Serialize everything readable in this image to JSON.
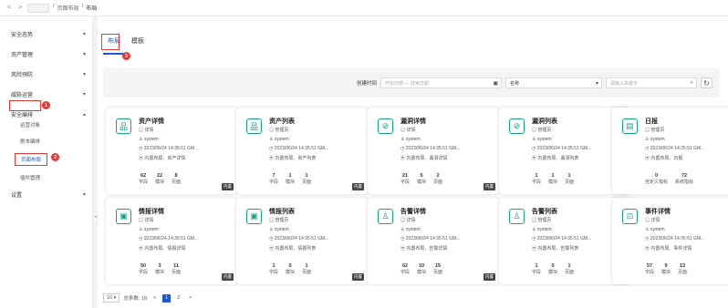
{
  "breadcrumb": {
    "back": "<",
    "forward": ">",
    "sep1": "/",
    "level1": "页面布局",
    "sep2": "/",
    "level2": "布局"
  },
  "sidebar": {
    "items": [
      {
        "label": "安全态势",
        "chev": "▾"
      },
      {
        "label": "资产管理",
        "chev": "▾"
      },
      {
        "label": "风险预防",
        "chev": "▾"
      },
      {
        "label": "威胁运营",
        "chev": "▾"
      },
      {
        "label": "安全编排",
        "chev": "▴"
      },
      {
        "label": "设置",
        "chev": "▾"
      }
    ],
    "subs": [
      "运营对象",
      "剧本编排",
      "页面布局",
      "插件管理"
    ],
    "collapse": "◂"
  },
  "badges": [
    "1",
    "2",
    "3"
  ],
  "tabs": [
    {
      "label": "布局"
    },
    {
      "label": "模板"
    }
  ],
  "filter": {
    "time_label": "创建时间",
    "date_placeholder": "开始日期 — 结束日期",
    "field_value": "名称",
    "keyword_placeholder": "请输入关键字",
    "calendar_glyph": "▣",
    "dropdown_glyph": "▾",
    "search_glyph": "⌕",
    "refresh_glyph": "↻"
  },
  "card_labels": {
    "field": "字段",
    "module": "模块",
    "page": "页面"
  },
  "cards": [
    {
      "title": "资产详情",
      "type": "详情",
      "user": "system",
      "time": "2023/06/24 14:35:51 GM...",
      "scope": "内置布局、资产详情",
      "fields": "62",
      "modules": "22",
      "pages": "8",
      "tag": "内置",
      "icon": "品"
    },
    {
      "title": "资产列表",
      "type": "管理页",
      "user": "system",
      "time": "2023/06/24 14:35:51 GM...",
      "scope": "内置布局、资产列表",
      "fields": "7",
      "modules": "1",
      "pages": "1",
      "tag": "内置",
      "icon": "品"
    },
    {
      "title": "漏洞详情",
      "type": "详情",
      "user": "system",
      "time": "2023/06/24 14:35:51 GM...",
      "scope": "内置布局、漏洞详情",
      "fields": "21",
      "modules": "5",
      "pages": "2",
      "tag": "内置",
      "icon": "⊘"
    },
    {
      "title": "漏洞列表",
      "type": "管理页",
      "user": "system",
      "time": "2023/06/24 14:35:51 GM...",
      "scope": "内置布局、漏洞列表",
      "fields": "1",
      "modules": "1",
      "pages": "1",
      "tag": "内置",
      "icon": "⊘"
    },
    {
      "title": "日报",
      "type": "管理页",
      "user": "system",
      "time": "2023/06/24 14:35:51 GM...",
      "scope": "内置布局、日报",
      "fields": "0",
      "modules": "72",
      "pages": "",
      "stat1_label": "自定义指标",
      "stat2_label": "系统指标",
      "tag": "内置",
      "icon": "▤"
    },
    {
      "title": "情报详情",
      "type": "详情",
      "user": "system",
      "time": "2023/06/24 14:35:51 GM...",
      "scope": "内置布局、情报详情",
      "fields": "50",
      "modules": "3",
      "pages": "11",
      "tag": "内置",
      "icon": "▣"
    },
    {
      "title": "情报列表",
      "type": "管理页",
      "user": "system",
      "time": "2023/06/24 14:35:51 GM...",
      "scope": "内置布局、情报列表",
      "fields": "1",
      "modules": "0",
      "pages": "1",
      "tag": "内置",
      "icon": "▣"
    },
    {
      "title": "告警详情",
      "type": "详情",
      "user": "system",
      "time": "2023/06/24 14:35:51 GM...",
      "scope": "内置布局、告警详情",
      "fields": "62",
      "modules": "10",
      "pages": "15",
      "tag": "内置",
      "icon": "♙"
    },
    {
      "title": "告警列表",
      "type": "管理页",
      "user": "system",
      "time": "2023/06/24 14:35:51 GM...",
      "scope": "内置布局、告警列表",
      "fields": "1",
      "modules": "0",
      "pages": "1",
      "tag": "内置",
      "icon": "♙"
    },
    {
      "title": "事件详情",
      "type": "详情",
      "user": "system",
      "time": "2023/06/24 14:35:51 GM...",
      "scope": "内置布局、事件详情",
      "fields": "57",
      "modules": "9",
      "pages": "13",
      "tag": "内置",
      "icon": "⊡"
    }
  ],
  "pager": {
    "size": "10",
    "size_chev": "▾",
    "total": "总条数: 18",
    "prev": "<",
    "p1": "1",
    "p2": "2",
    "next": ">"
  },
  "colors": {
    "accent": "#1a56db",
    "annotation": "#e53935",
    "card_icon": "#16a085"
  }
}
